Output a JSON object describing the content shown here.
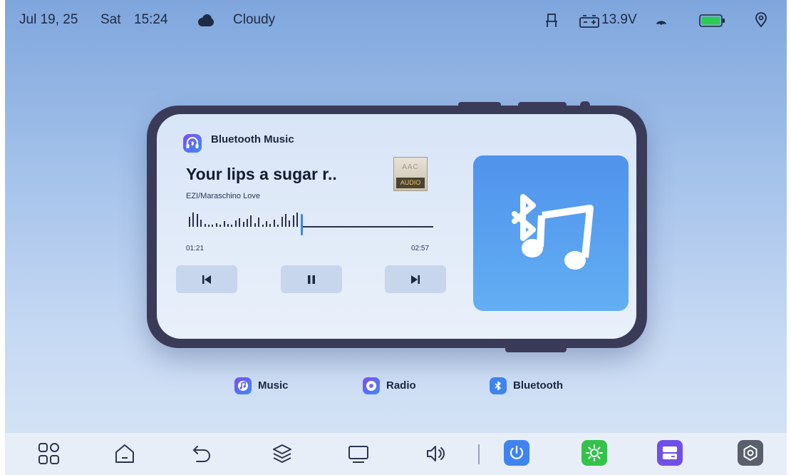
{
  "status_bar": {
    "date": "Jul 19, 25",
    "day": "Sat",
    "time": "15:24",
    "weather_icon": "cloud-icon",
    "weather": "Cloudy",
    "voltage": "13.9V",
    "icons": [
      "seat-icon",
      "car-battery-icon",
      "signal-icon",
      "battery-icon",
      "location-icon"
    ]
  },
  "player": {
    "app_name": "Bluetooth Music",
    "song_title": "Your lips a sugar r..",
    "artist": "EZI/Maraschino Love",
    "codec_top": "AAC",
    "codec_bottom": "AUDIO",
    "elapsed": "01:21",
    "duration": "02:57",
    "progress": 0.457,
    "controls": [
      "previous-icon",
      "pause-icon",
      "next-icon"
    ],
    "album_art_icon": "bluetooth-music-icon"
  },
  "sources": [
    {
      "label": "Music",
      "icon": "music-icon"
    },
    {
      "label": "Radio",
      "icon": "radio-icon"
    },
    {
      "label": "Bluetooth",
      "icon": "bluetooth-icon"
    }
  ],
  "dock": {
    "items": [
      "apps-grid-icon",
      "home-icon",
      "back-icon",
      "layers-icon",
      "screen-icon",
      "volume-icon",
      "power-icon",
      "brightness-icon",
      "storage-icon",
      "settings-icon"
    ],
    "colors": {
      "power": "#3f83ee",
      "brightness": "#33c24b",
      "storage": "#6f4fe6",
      "settings": "#5a5f6e"
    }
  }
}
